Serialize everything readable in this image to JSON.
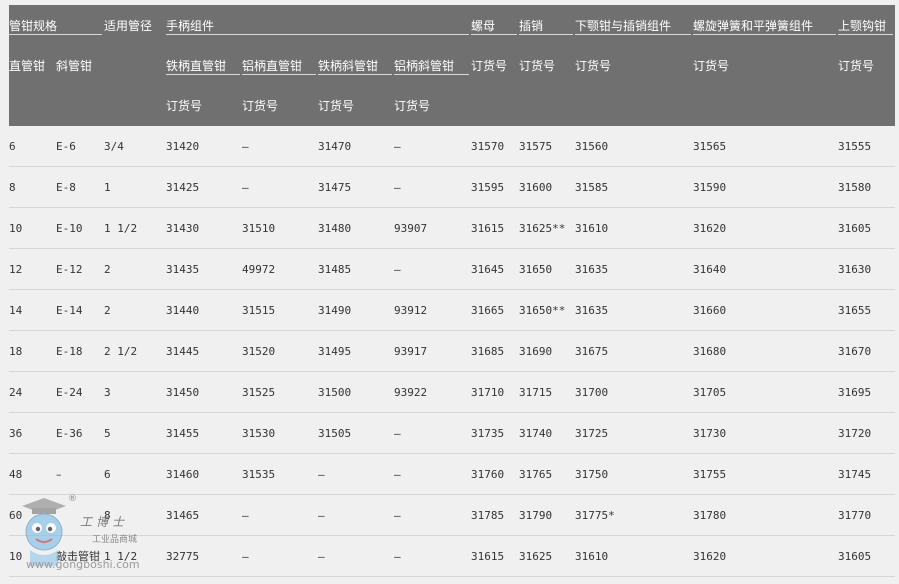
{
  "table": {
    "header": {
      "size": "管钳规格",
      "pipe_range": "适用管径",
      "handle_assembly": "手柄组件",
      "nut": "螺母",
      "pin": "插销",
      "lower_jaw": "下颚钳与插销组件",
      "spring": "螺旋弹簧和平弹簧组件",
      "upper_jaw": "上颚钩钳",
      "straight": "直管钳",
      "end": "斜管钳",
      "iron_straight": "铁柄直管钳",
      "alu_straight": "铝柄直管钳",
      "iron_end": "铁柄斜管钳",
      "alu_end": "铝柄斜管钳",
      "order_no": "订货号"
    },
    "rows": [
      [
        "6",
        "E-6",
        "3/4",
        "31420",
        "–",
        "31470",
        "–",
        "31570",
        "31575",
        "31560",
        "31565",
        "31555"
      ],
      [
        "8",
        "E-8",
        "1",
        "31425",
        "–",
        "31475",
        "–",
        "31595",
        "31600",
        "31585",
        "31590",
        "31580"
      ],
      [
        "10",
        "E-10",
        "1 1/2",
        "31430",
        "31510",
        "31480",
        "93907",
        "31615",
        "31625**",
        "31610",
        "31620",
        "31605"
      ],
      [
        "12",
        "E-12",
        "2",
        "31435",
        "49972",
        "31485",
        "–",
        "31645",
        "31650",
        "31635",
        "31640",
        "31630"
      ],
      [
        "14",
        "E-14",
        "2",
        "31440",
        "31515",
        "31490",
        "93912",
        "31665",
        "31650**",
        "31635",
        "31660",
        "31655"
      ],
      [
        "18",
        "E-18",
        "2 1/2",
        "31445",
        "31520",
        "31495",
        "93917",
        "31685",
        "31690",
        "31675",
        "31680",
        "31670"
      ],
      [
        "24",
        "E-24",
        "3",
        "31450",
        "31525",
        "31500",
        "93922",
        "31710",
        "31715",
        "31700",
        "31705",
        "31695"
      ],
      [
        "36",
        "E-36",
        "5",
        "31455",
        "31530",
        "31505",
        "–",
        "31735",
        "31740",
        "31725",
        "31730",
        "31720"
      ],
      [
        "48",
        "–",
        "6",
        "31460",
        "31535",
        "–",
        "–",
        "31760",
        "31765",
        "31750",
        "31755",
        "31745"
      ],
      [
        "60",
        "",
        "8",
        "31465",
        "–",
        "–",
        "–",
        "31785",
        "31790",
        "31775*",
        "31780",
        "31770"
      ],
      [
        "10",
        "敲击管钳",
        "1 1/2",
        "32775",
        "–",
        "–",
        "–",
        "31615",
        "31625",
        "31610",
        "31620",
        "31605"
      ]
    ]
  },
  "watermark": {
    "brand": "工博士",
    "sub": "工业品商城",
    "url": "www.gongboshi.com",
    "reg": "®"
  }
}
